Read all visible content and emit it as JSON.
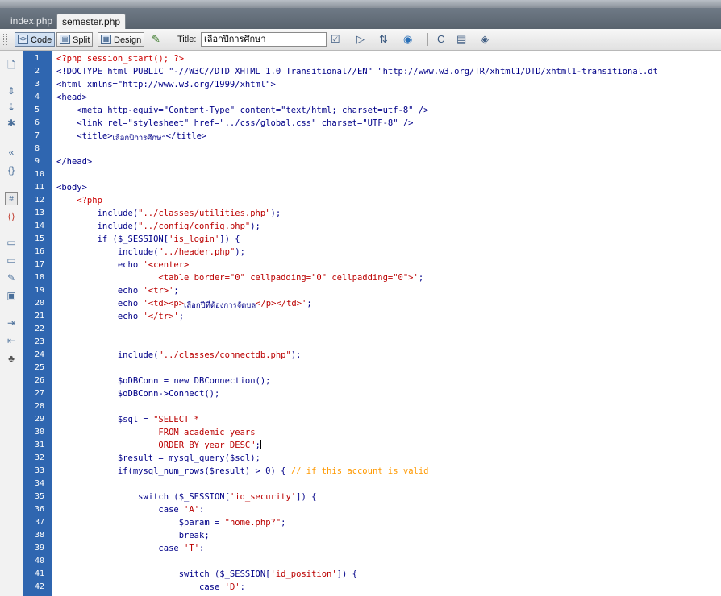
{
  "tabs": [
    {
      "label": "index.php",
      "active": false
    },
    {
      "label": "semester.php",
      "active": true
    }
  ],
  "toolbar": {
    "view_buttons": [
      "Code",
      "Split",
      "Design"
    ],
    "title_label": "Title:",
    "title_value": "เลือกปีการศึกษา",
    "icons": [
      "validate-icon",
      "preview-icon",
      "refresh-design-icon",
      "browser-icon",
      "check-page-icon",
      "view-options-icon",
      "visual-aids-icon"
    ]
  },
  "sidebar_icons": [
    "open-documents-icon",
    "collapse-full-tag-icon",
    "collapse-selection-icon",
    "expand-all-icon",
    "select-parent-tag-icon",
    "balance-braces-icon",
    "line-numbers-icon",
    "highlight-invalid-code-icon",
    "apply-comment-icon",
    "remove-comment-icon",
    "wrap-tag-icon",
    "recent-snippets-icon",
    "indent-code-icon",
    "outdent-code-icon",
    "format-source-icon"
  ],
  "editor": {
    "line_numbers": [
      "1",
      "2",
      "3",
      "4",
      "5",
      "6",
      "7",
      "8",
      "9",
      "10",
      "11",
      "12",
      "13",
      "14",
      "15",
      "16",
      "17",
      "18",
      "19",
      "20",
      "21",
      "22",
      "23",
      "24",
      "25",
      "26",
      "27",
      "28",
      "29",
      "30",
      "31",
      "32",
      "33",
      "34",
      "35",
      "36",
      "37",
      "38",
      "39",
      "40",
      "41",
      "42"
    ],
    "lines": [
      [
        [
          "php",
          "<?php session_start(); ?>"
        ]
      ],
      [
        [
          "tag",
          "<!DOCTYPE html PUBLIC \"-//W3C//DTD XHTML 1.0 Transitional//EN\" \"http://www.w3.org/TR/xhtml1/DTD/xhtml1-transitional.dt"
        ]
      ],
      [
        [
          "tag",
          "<html xmlns=\"http://www.w3.org/1999/xhtml\">"
        ]
      ],
      [
        [
          "tag",
          "<head>"
        ]
      ],
      [
        [
          "tag",
          "    <meta http-equiv=\"Content-Type\" content=\"text/html; charset=utf-8\" />"
        ]
      ],
      [
        [
          "tag",
          "    <link rel=\"stylesheet\" href=\"../css/global.css\" charset=\"UTF-8\" />"
        ]
      ],
      [
        [
          "tag",
          "    <title>"
        ],
        [
          "thai",
          "เลือกปีการศึกษา"
        ],
        [
          "tag",
          "</title>"
        ]
      ],
      [],
      [
        [
          "tag",
          "</head>"
        ]
      ],
      [],
      [
        [
          "tag",
          "<body>"
        ]
      ],
      [
        [
          "php",
          "    <?php"
        ]
      ],
      [
        [
          "def",
          "        include("
        ],
        [
          "str",
          "\"../classes/utilities.php\""
        ],
        [
          "def",
          ");"
        ]
      ],
      [
        [
          "def",
          "        include("
        ],
        [
          "str",
          "\"../config/config.php\""
        ],
        [
          "def",
          ");"
        ]
      ],
      [
        [
          "def",
          "        if ($_SESSION["
        ],
        [
          "str",
          "'is_login'"
        ],
        [
          "def",
          "]) {"
        ]
      ],
      [
        [
          "def",
          "            include("
        ],
        [
          "str",
          "\"../header.php\""
        ],
        [
          "def",
          ");"
        ]
      ],
      [
        [
          "def",
          "            echo "
        ],
        [
          "str",
          "'<center>"
        ]
      ],
      [
        [
          "str",
          "                    <table border=\"0\" cellpadding=\"0\" cellpadding=\"0\">'"
        ],
        [
          "def",
          ";"
        ]
      ],
      [
        [
          "def",
          "            echo "
        ],
        [
          "str",
          "'<tr>'"
        ],
        [
          "def",
          ";"
        ]
      ],
      [
        [
          "def",
          "            echo "
        ],
        [
          "str",
          "'<td><p>"
        ],
        [
          "thai",
          "เลือกปีที่ต้องการจัดบล"
        ],
        [
          "str",
          "</p></td>'"
        ],
        [
          "def",
          ";"
        ]
      ],
      [
        [
          "def",
          "            echo "
        ],
        [
          "str",
          "'</tr>'"
        ],
        [
          "def",
          ";"
        ]
      ],
      [],
      [],
      [
        [
          "def",
          "            include("
        ],
        [
          "str",
          "\"../classes/connectdb.php\""
        ],
        [
          "def",
          ");"
        ]
      ],
      [],
      [
        [
          "def",
          "            $oDBConn = new DBConnection();"
        ]
      ],
      [
        [
          "def",
          "            $oDBConn->Connect();"
        ]
      ],
      [],
      [
        [
          "def",
          "            $sql = "
        ],
        [
          "str",
          "\"SELECT *"
        ]
      ],
      [
        [
          "str",
          "                    FROM academic_years"
        ]
      ],
      [
        [
          "str",
          "                    ORDER BY year DESC\""
        ],
        [
          "def",
          ";"
        ],
        [
          "caret",
          ""
        ]
      ],
      [
        [
          "def",
          "            $result = mysql_query($sql);"
        ]
      ],
      [
        [
          "def",
          "            if(mysql_num_rows($result) > 0) { "
        ],
        [
          "com",
          "// if this account is valid"
        ]
      ],
      [],
      [
        [
          "def",
          "                switch ($_SESSION["
        ],
        [
          "str",
          "'id_security'"
        ],
        [
          "def",
          "]) {"
        ]
      ],
      [
        [
          "def",
          "                    case "
        ],
        [
          "str",
          "'A'"
        ],
        [
          "def",
          ":"
        ]
      ],
      [
        [
          "def",
          "                        $param = "
        ],
        [
          "str",
          "\"home.php?\""
        ],
        [
          "def",
          ";"
        ]
      ],
      [
        [
          "def",
          "                        break;"
        ]
      ],
      [
        [
          "def",
          "                    case "
        ],
        [
          "str",
          "'T'"
        ],
        [
          "def",
          ":"
        ]
      ],
      [],
      [
        [
          "def",
          "                        switch ($_SESSION["
        ],
        [
          "str",
          "'id_position'"
        ],
        [
          "def",
          "]) {"
        ]
      ],
      [
        [
          "def",
          "                            case "
        ],
        [
          "str",
          "'D'"
        ],
        [
          "def",
          ":"
        ]
      ]
    ]
  }
}
